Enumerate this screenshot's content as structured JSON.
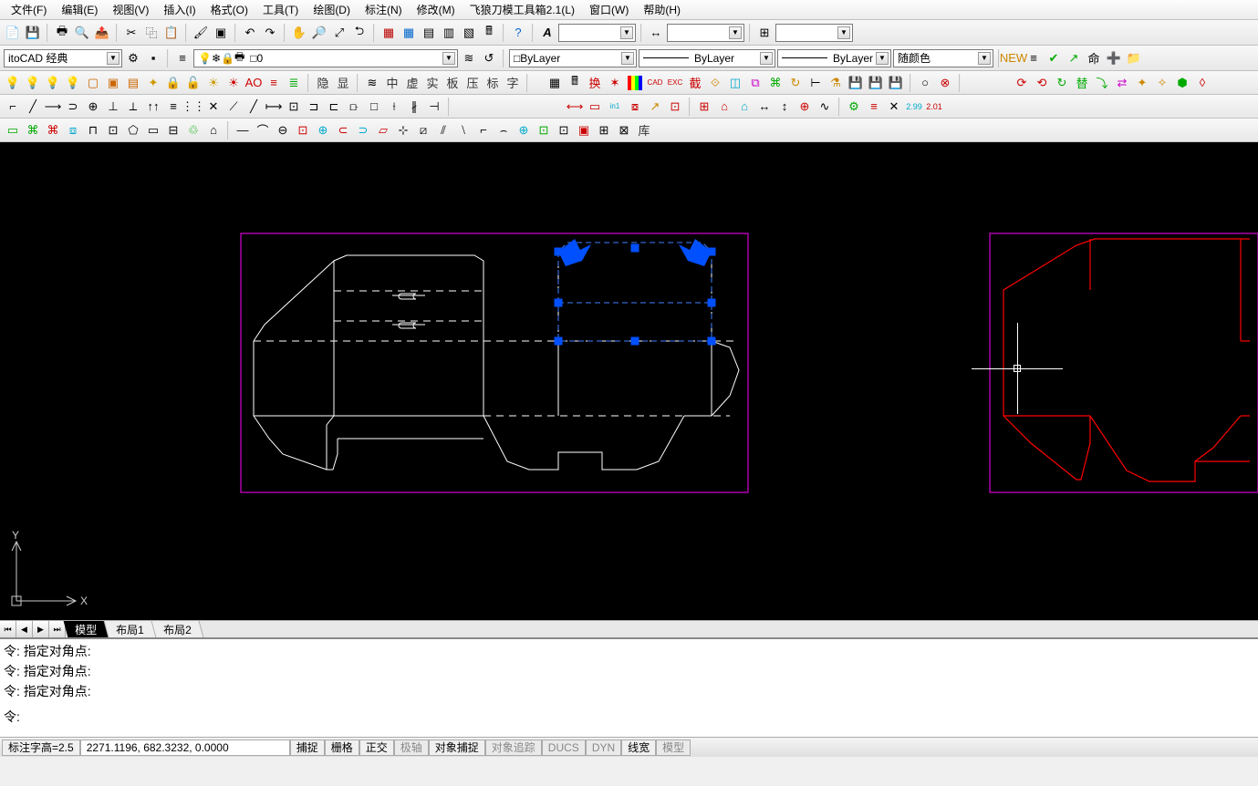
{
  "menu": {
    "items": [
      "文件(F)",
      "编辑(E)",
      "视图(V)",
      "插入(I)",
      "格式(O)",
      "工具(T)",
      "绘图(D)",
      "标注(N)",
      "修改(M)",
      "飞狼刀模工具箱2.1(L)",
      "窗口(W)",
      "帮助(H)"
    ]
  },
  "workspace": {
    "combo_value": "itoCAD 经典"
  },
  "layer": {
    "combo_value": "□0"
  },
  "properties": {
    "color_combo": "□ByLayer",
    "linetype_combo": "ByLayer",
    "lineweight_combo": "ByLayer",
    "plotstyle_combo": "随颜色"
  },
  "cjk_toolbar1": [
    "隐",
    "显"
  ],
  "cjk_toolbar2": [
    "中",
    "虚",
    "实",
    "板",
    "压",
    "标",
    "字"
  ],
  "cjk_toolbar3": [
    "换"
  ],
  "cjk_toolbar4": [
    "截"
  ],
  "cjk_toolbar5": [
    "库"
  ],
  "cjk_toolbar6": [
    "替"
  ],
  "tabs": {
    "active": "模型",
    "items": [
      "模型",
      "布局1",
      "布局2"
    ]
  },
  "command_history": [
    "令: 指定对角点:",
    "令: 指定对角点:",
    "令: 指定对角点:"
  ],
  "command_prompt": "令:",
  "status": {
    "left_label": "标注字高=2.5",
    "coords": "2271.1196, 682.3232, 0.0000",
    "toggles": [
      "捕捉",
      "栅格",
      "正交",
      "极轴",
      "对象捕捉",
      "对象追踪",
      "DUCS",
      "DYN",
      "线宽",
      "模型"
    ]
  }
}
